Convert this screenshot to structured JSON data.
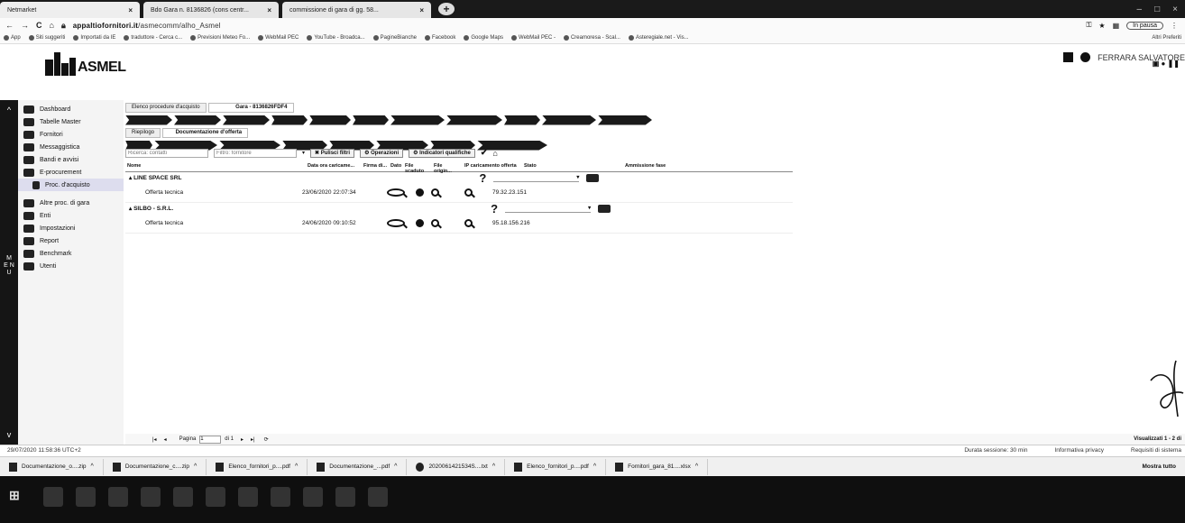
{
  "browser": {
    "tabs": [
      {
        "title": "Netmarket"
      },
      {
        "title": "Bdo Gara n. 8136826 (cons centr..."
      },
      {
        "title": "commissione di gara di gg. 58..."
      }
    ],
    "url_host": "appaltiofornitori.it",
    "url_path": "/asmecomm/alho_Asmel",
    "profile_label": "In pausa",
    "bookmarks": [
      "App",
      "Siti suggeriti",
      "Importati da IE",
      "traduttore - Cerca c...",
      "Previsioni Meteo Fo...",
      "WebMail PEC",
      "YouTube - Broadca...",
      "PagineBianche",
      "Facebook",
      "Google Maps",
      "WebMail PEC -",
      "Creamoresa - Scal...",
      "Asteregiale.net - Vis..."
    ],
    "bookmarks_right": "Altri Preferiti"
  },
  "app": {
    "logo_text": "ASMEL",
    "user_name": "FERRARA SALVATORE"
  },
  "sidebar": {
    "vertical_label": "M E N U",
    "items": [
      {
        "label": "Dashboard",
        "icon": "dashboard-icon"
      },
      {
        "label": "Tabelle Master",
        "icon": "table-icon"
      },
      {
        "label": "Fornitori",
        "icon": "truck-icon"
      },
      {
        "label": "Messaggistica",
        "icon": "message-icon"
      },
      {
        "label": "Bandi e avvisi",
        "icon": "megaphone-icon"
      },
      {
        "label": "E-procurement",
        "icon": "procurement-icon"
      },
      {
        "label": "Proc. d'acquisto",
        "icon": "list-icon",
        "sub": true
      },
      {
        "label": "Altre proc. di gara",
        "icon": "gavel-icon"
      },
      {
        "label": "Enti",
        "icon": "building-icon"
      },
      {
        "label": "Impostazioni",
        "icon": "gear-icon"
      },
      {
        "label": "Report",
        "icon": "report-icon"
      },
      {
        "label": "Benchmark",
        "icon": "benchmark-icon"
      },
      {
        "label": "Utenti",
        "icon": "users-icon"
      }
    ]
  },
  "breadcrumbs": {
    "row1": [
      "Elenco procedure d'acquisto",
      "Gara - 8136826FDF4"
    ],
    "row3": [
      "Riepilogo",
      "Documentazione d'offerta"
    ]
  },
  "toolbar": {
    "search_placeholder": "Ricerca: contatti",
    "filter_placeholder": "Filtro: fornitore",
    "clear_filters": "Pulisci filtri",
    "operations": "Operazioni",
    "qualification": "Indicatori qualifiche"
  },
  "grid": {
    "columns": [
      "Nome",
      "Data ora caricame...",
      "Firma di...",
      "Dato",
      "File scaduto",
      "File origin...",
      "IP caricamento offerta",
      "Stato",
      "Ammissione fase"
    ],
    "groups": [
      {
        "name": "LINE SPACE SRL",
        "rows": [
          {
            "name": "Offerta tecnica",
            "date": "23/06/2020 22:07:34",
            "ip": "79.32.23.151"
          }
        ]
      },
      {
        "name": "SILBO - S.R.L.",
        "rows": [
          {
            "name": "Offerta tecnica",
            "date": "24/06/2020 09:10:52",
            "ip": "95.18.156.216"
          }
        ]
      }
    ]
  },
  "pager": {
    "label": "Pagina",
    "page": "1",
    "of": "di 1",
    "visible": "Visualizzati 1 - 2 di"
  },
  "status": {
    "left": "29/07/2020 11:58:36 UTC+2",
    "session": "Durata sessione: 30 min",
    "privacy": "Informativa privacy",
    "requirements": "Requisiti di sistema"
  },
  "downloads": {
    "items": [
      "Documentazione_o....zip",
      "Documentazione_c....zip",
      "Elenco_fornitori_p....pdf",
      "Documentazione_...pdf",
      "2020061421534S....txt",
      "Elenco_fornitori_p....pdf",
      "Fornitori_gara_81....xlsx"
    ],
    "show_all": "Mostra tutto"
  }
}
